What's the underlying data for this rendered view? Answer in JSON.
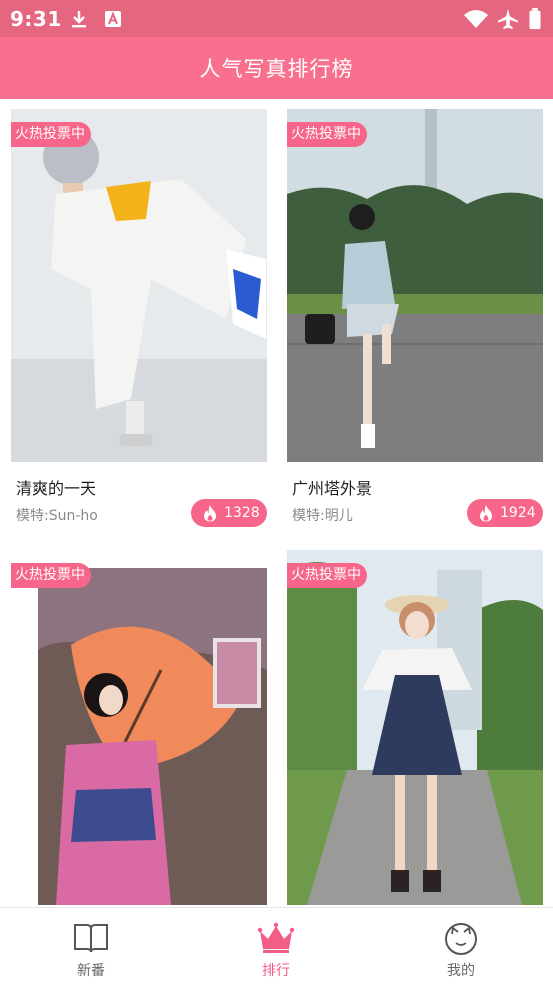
{
  "status_bar": {
    "time": "9:31"
  },
  "header": {
    "title": "人气写真排行榜"
  },
  "cards": [
    {
      "badge": "火热投票中",
      "title": "清爽的一天",
      "model": "模特:Sun-ho",
      "votes": "1328"
    },
    {
      "badge": "火热投票中",
      "title": "广州塔外景",
      "model": "模特:明儿",
      "votes": "1924"
    },
    {
      "badge": "火热投票中"
    },
    {
      "badge": "火热投票中"
    }
  ],
  "nav": {
    "items": [
      {
        "label": "新番",
        "icon": "book-icon"
      },
      {
        "label": "排行",
        "icon": "crown-icon",
        "active": true
      },
      {
        "label": "我的",
        "icon": "cat-face-icon"
      }
    ]
  },
  "colors": {
    "accent": "#f9708e",
    "status_bar": "#e4667f",
    "active": "#f25e86"
  }
}
